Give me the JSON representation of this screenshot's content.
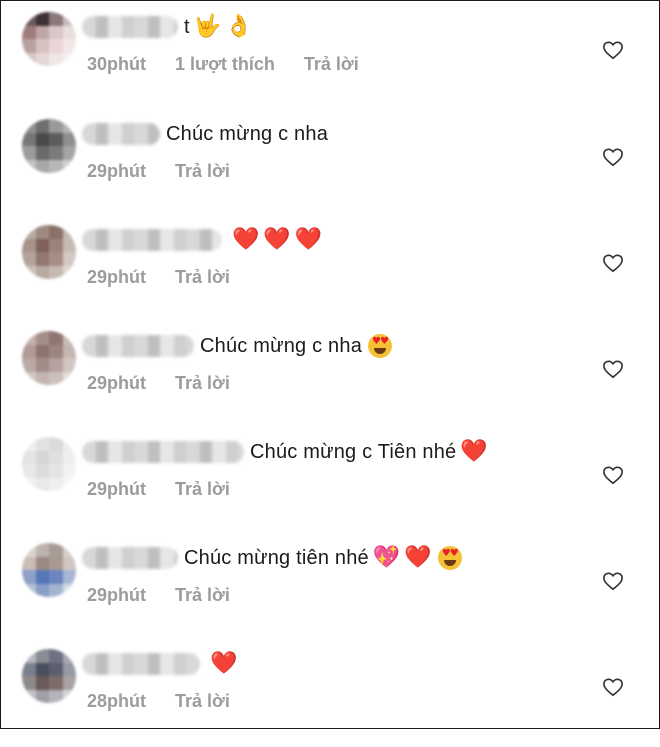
{
  "comments": [
    {
      "text": "t",
      "emojis": [
        "🤟",
        "👌"
      ],
      "time": "30phút",
      "likes": "1 lượt thích",
      "reply": "Trả lời",
      "avatar_colors": [
        "#6b5b5b",
        "#3d2f33",
        "#8a7a7a",
        "#c9bcbc",
        "#9e7c7c",
        "#c0a7a7",
        "#d8c8c8",
        "#e8dede",
        "#b9a1a2",
        "#d7c1c1",
        "#ead6d6",
        "#f2e8e8",
        "#d9c6c6",
        "#e7d6d6",
        "#f1e6e6",
        "#f6efef"
      ]
    },
    {
      "text": "Chúc mừng c nha",
      "emojis": [],
      "time": "29phút",
      "reply": "Trả lời",
      "avatar_colors": [
        "#8e8e8e",
        "#6f6f6f",
        "#9a9a9a",
        "#b4b4b4",
        "#777777",
        "#4a4a4a",
        "#5c5c5c",
        "#8f8f8f",
        "#9c9c9c",
        "#6a6a6a",
        "#7b7b7b",
        "#a5a5a5",
        "#c2c2c2",
        "#a8a8a8",
        "#b7b7b7",
        "#cfcfcf"
      ]
    },
    {
      "text": "",
      "emojis": [
        "❤️",
        "❤️",
        "❤️"
      ],
      "time": "29phút",
      "reply": "Trả lời",
      "avatar_colors": [
        "#b9aaa3",
        "#a08a80",
        "#8a7167",
        "#c4b7b1",
        "#a6938a",
        "#7f6258",
        "#9d8379",
        "#c7bab4",
        "#b4a39b",
        "#94786d",
        "#a88f85",
        "#d3c8c3",
        "#ccc1bc",
        "#b9aaa2",
        "#c6b9b3",
        "#e0d8d5"
      ]
    },
    {
      "text": "Chúc mừng c nha",
      "emojis": [
        "😍"
      ],
      "time": "29phút",
      "reply": "Trả lời",
      "avatar_colors": [
        "#c2b1ad",
        "#a58f8a",
        "#8f7672",
        "#c9bab7",
        "#b19b96",
        "#8e7470",
        "#9c8480",
        "#c6b6b2",
        "#bba9a5",
        "#a38c88",
        "#b5a19d",
        "#d2c5c2",
        "#d4c8c5",
        "#c3b4b1",
        "#cdbfbc",
        "#e4dcda"
      ]
    },
    {
      "text": "Chúc mừng c Tiên nhé",
      "emojis": [
        "❤️"
      ],
      "time": "29phút",
      "reply": "Trả lời",
      "avatar_colors": [
        "#eeeeee",
        "#e2e2e2",
        "#dadada",
        "#ededed",
        "#e4e4e4",
        "#d6d6d6",
        "#e0e0e0",
        "#efefef",
        "#e8e8e8",
        "#dcdcdc",
        "#e5e5e5",
        "#f2f2f2",
        "#f1f1f1",
        "#e9e9e9",
        "#eeeeee",
        "#f6f6f6"
      ]
    },
    {
      "text": "Chúc mừng tiên nhé",
      "emojis": [
        "💖",
        "❤️",
        "😍"
      ],
      "time": "29phút",
      "reply": "Trả lời",
      "avatar_colors": [
        "#d9d3cf",
        "#bfb3ad",
        "#a89b95",
        "#d6ceca",
        "#c9bdb6",
        "#9b8a82",
        "#a99990",
        "#d0c6c1",
        "#8da0c8",
        "#5577b8",
        "#6a86c0",
        "#a8b6d3",
        "#b6c1d7",
        "#8a9ec6",
        "#a4b3d0",
        "#d6dbe6"
      ]
    },
    {
      "text": "",
      "emojis": [
        "❤️"
      ],
      "time": "28phút",
      "reply": "Trả lời",
      "avatar_colors": [
        "#b7b7be",
        "#8a8c96",
        "#6e7280",
        "#a6a8b2",
        "#7a7f8c",
        "#4a4e5c",
        "#5b5f6d",
        "#969aa6",
        "#8e8a8a",
        "#6a5a58",
        "#7c6c68",
        "#a8a2a2",
        "#c2c2c6",
        "#a0a0a8",
        "#b4b4ba",
        "#d6d6da"
      ]
    }
  ]
}
